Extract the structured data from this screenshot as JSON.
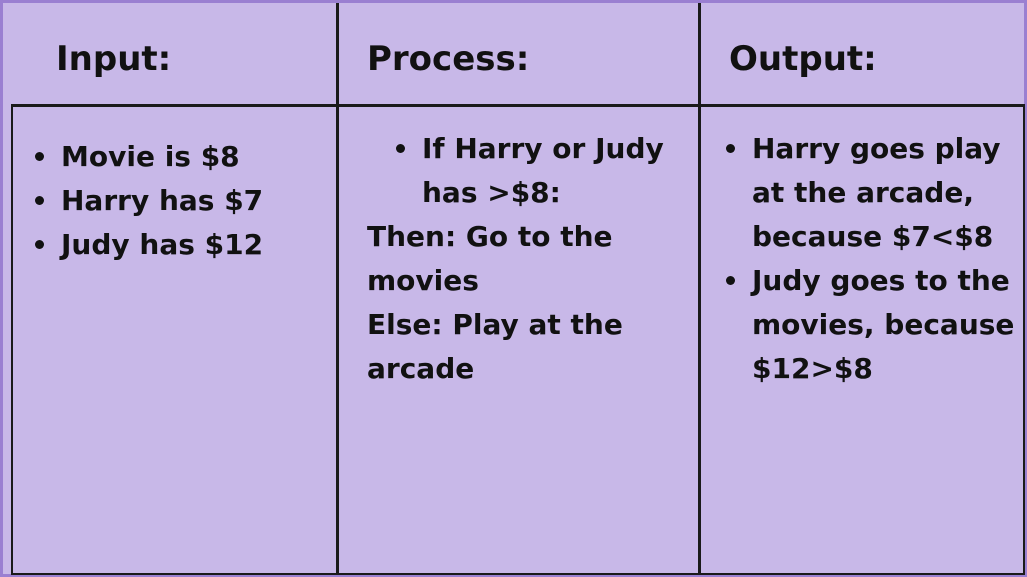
{
  "columns": {
    "input": {
      "header": "Input:",
      "items": [
        "Movie is $8",
        "Harry has $7",
        "Judy has $12"
      ]
    },
    "process": {
      "header": "Process:",
      "bullet": "If Harry or Judy has >$8:",
      "then_text": "Then: Go to the movies",
      "else_text": "Else: Play at the arcade"
    },
    "output": {
      "header": "Output:",
      "items": [
        "Harry goes play at the arcade, because $7<$8",
        "Judy goes to the movies, because $12>$8"
      ]
    }
  },
  "colors": {
    "background": "#c8b8e8",
    "border": "#9a7fd1",
    "lines": "#1a1a1a"
  }
}
